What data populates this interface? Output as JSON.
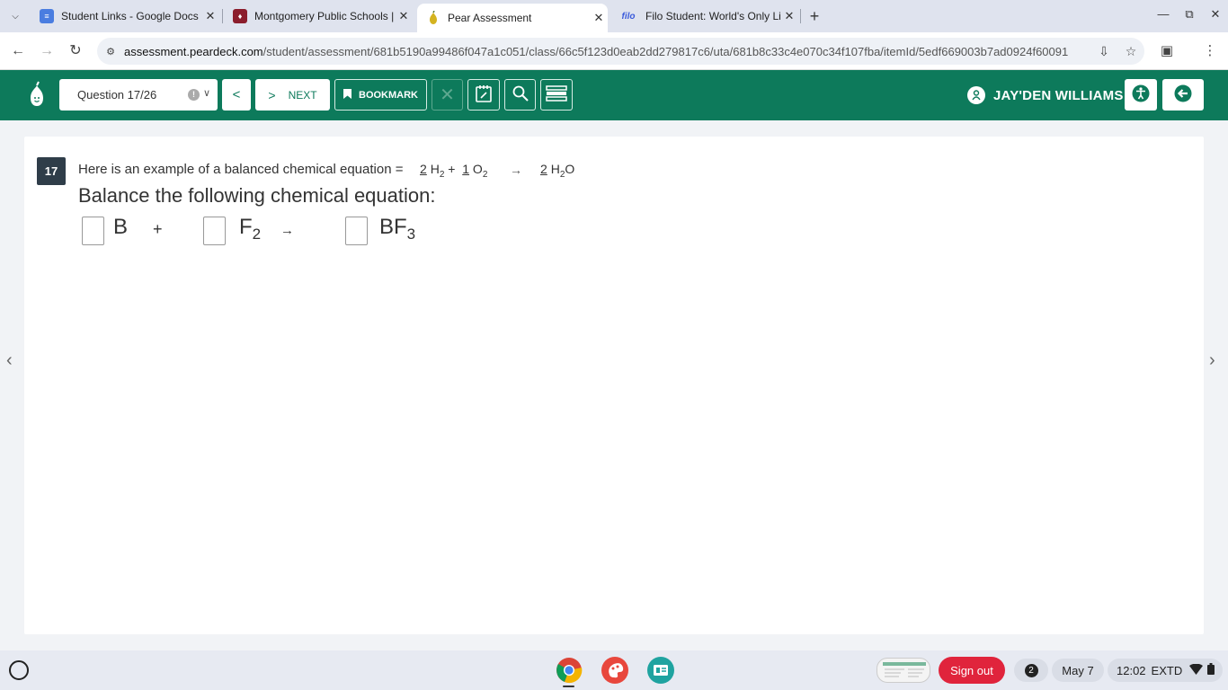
{
  "browser": {
    "tabs": [
      {
        "title": "Student Links - Google Docs",
        "favicon": "google-docs-icon",
        "color": "#4a7de0"
      },
      {
        "title": "Montgomery Public Schools | H",
        "favicon": "school-crest-icon",
        "color": "#8b1d2c"
      },
      {
        "title": "Pear Assessment",
        "favicon": "pear-icon",
        "color": "#0d7a5b"
      },
      {
        "title": "Filo Student: World's Only Live",
        "favicon": "filo-icon",
        "color": "#3b5bdb"
      }
    ],
    "url_host": "assessment.peardeck.com",
    "url_path": "/student/assessment/681b5190a99486f047a1c051/class/66c5f123d0eab2dd279817c6/uta/681b8c33c4e070c34f107fba/itemId/5edf669003b7ad0924f60091"
  },
  "header": {
    "question_select": "Question 17/26",
    "next_label": "NEXT",
    "bookmark_label": "BOOKMARK",
    "user_name": "JAY'DEN WILLIAMS",
    "brand_color": "#0d7a5b"
  },
  "question": {
    "number": "17",
    "example_text": "Here is an example of a balanced chemical equation =",
    "example": {
      "c1": "2",
      "r1": "H",
      "r1sub": "2",
      "plus": "+",
      "c2": "1",
      "r2": "O",
      "r2sub": "2",
      "arrow": "→",
      "c3": "2",
      "p1a": "H",
      "p1sub": "2",
      "p1b": "O"
    },
    "prompt": "Balance the following chemical equation:",
    "equation": {
      "term1": "B",
      "plus": "+",
      "term2": "F",
      "term2sub": "2",
      "arrow": "→",
      "product": "BF",
      "product_sub": "3"
    }
  },
  "shelf": {
    "signout_label": "Sign out",
    "notification_count": "2",
    "date": "May 7",
    "time": "12:02",
    "tz": "EXTD"
  }
}
